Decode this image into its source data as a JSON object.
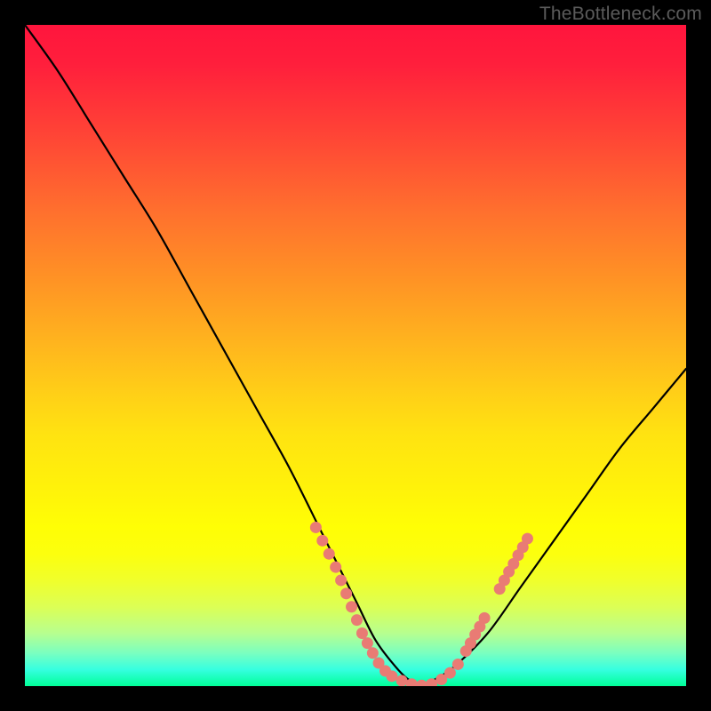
{
  "watermark": "TheBottleneck.com",
  "chart_data": {
    "type": "line",
    "title": "",
    "xlabel": "",
    "ylabel": "",
    "xlim": [
      0,
      100
    ],
    "ylim": [
      0,
      100
    ],
    "series": [
      {
        "name": "bottleneck-curve",
        "x": [
          0,
          5,
          10,
          15,
          20,
          25,
          30,
          35,
          40,
          45,
          50,
          53,
          56,
          58,
          60,
          62,
          65,
          70,
          75,
          80,
          85,
          90,
          95,
          100
        ],
        "values": [
          100,
          93,
          85,
          77,
          69,
          60,
          51,
          42,
          33,
          23,
          13,
          7,
          3,
          1,
          0,
          1,
          3,
          8,
          15,
          22,
          29,
          36,
          42,
          48
        ]
      }
    ],
    "markers": {
      "name": "highlight-dots",
      "color": "#e97b74",
      "points": [
        {
          "x": 44,
          "y": 24
        },
        {
          "x": 45,
          "y": 22
        },
        {
          "x": 46,
          "y": 20
        },
        {
          "x": 47,
          "y": 18
        },
        {
          "x": 47.8,
          "y": 16
        },
        {
          "x": 48.6,
          "y": 14
        },
        {
          "x": 49.4,
          "y": 12
        },
        {
          "x": 50.2,
          "y": 10
        },
        {
          "x": 51,
          "y": 8
        },
        {
          "x": 51.8,
          "y": 6.5
        },
        {
          "x": 52.6,
          "y": 5
        },
        {
          "x": 53.5,
          "y": 3.5
        },
        {
          "x": 54.5,
          "y": 2.3
        },
        {
          "x": 55.5,
          "y": 1.5
        },
        {
          "x": 57,
          "y": 0.8
        },
        {
          "x": 58.5,
          "y": 0.3
        },
        {
          "x": 60,
          "y": 0.1
        },
        {
          "x": 61.5,
          "y": 0.3
        },
        {
          "x": 63,
          "y": 1
        },
        {
          "x": 64.3,
          "y": 2
        },
        {
          "x": 65.5,
          "y": 3.3
        },
        {
          "x": 66.7,
          "y": 5.3
        },
        {
          "x": 67.4,
          "y": 6.5
        },
        {
          "x": 68.1,
          "y": 7.8
        },
        {
          "x": 68.8,
          "y": 9
        },
        {
          "x": 69.5,
          "y": 10.3
        },
        {
          "x": 71.8,
          "y": 14.7
        },
        {
          "x": 72.5,
          "y": 16
        },
        {
          "x": 73.2,
          "y": 17.3
        },
        {
          "x": 73.9,
          "y": 18.5
        },
        {
          "x": 74.6,
          "y": 19.8
        },
        {
          "x": 75.3,
          "y": 21
        },
        {
          "x": 76,
          "y": 22.3
        }
      ]
    }
  }
}
